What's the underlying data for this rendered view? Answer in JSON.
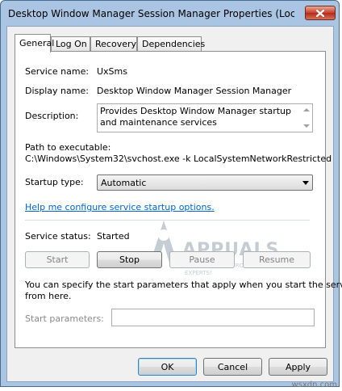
{
  "window": {
    "title": "Desktop Window Manager Session Manager Properties (Local Com..."
  },
  "tabs": [
    {
      "label": "General"
    },
    {
      "label": "Log On"
    },
    {
      "label": "Recovery"
    },
    {
      "label": "Dependencies"
    }
  ],
  "general": {
    "service_name_label": "Service name:",
    "service_name_value": "UxSms",
    "display_name_label": "Display name:",
    "display_name_value": "Desktop Window Manager Session Manager",
    "description_label": "Description:",
    "description_value": "Provides Desktop Window Manager startup and maintenance services",
    "path_label": "Path to executable:",
    "path_value": "C:\\Windows\\System32\\svchost.exe -k LocalSystemNetworkRestricted",
    "startup_type_label": "Startup type:",
    "startup_type_value": "Automatic",
    "help_link": "Help me configure service startup options.",
    "service_status_label": "Service status:",
    "service_status_value": "Started",
    "start_button": "Start",
    "stop_button": "Stop",
    "pause_button": "Pause",
    "resume_button": "Resume",
    "info_text_line1": "You can specify the start parameters that apply when you start the service",
    "info_text_line2": "from here.",
    "start_params_label": "Start parameters:",
    "start_params_value": ""
  },
  "footer": {
    "ok_button": "OK",
    "cancel_button": "Cancel",
    "apply_button": "Apply"
  },
  "watermark": {
    "brand": "APPUALS",
    "tagline": "TECH HOW-TO'S FROM THE EXPERTS!",
    "site": "wsxdn.com"
  },
  "colors": {
    "title_bar": "#a9c5e3",
    "close_button": "#c7402b",
    "link": "#0066cc"
  }
}
